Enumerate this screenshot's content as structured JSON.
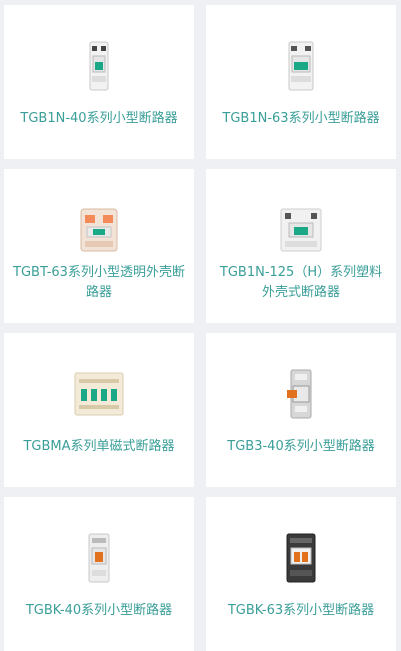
{
  "products": [
    {
      "name": "TGB1N-40系列小型断路器",
      "icon": "mcb-1p-icon"
    },
    {
      "name": "TGB1N-63系列小型断路器",
      "icon": "mcb-2p-icon"
    },
    {
      "name": "TGBT-63系列小型透明外壳断路器",
      "icon": "mcb-transparent-icon"
    },
    {
      "name": "TGB1N-125（H）系列塑料外壳式断路器",
      "icon": "mcb-125-icon"
    },
    {
      "name": "TGBMA系列单磁式断路器",
      "icon": "mcb-4p-icon"
    },
    {
      "name": "TGB3-40系列小型断路器",
      "icon": "mcb-din-icon"
    },
    {
      "name": "TGBK-40系列小型断路器",
      "icon": "mcb-tgbk40-icon"
    },
    {
      "name": "TGBK-63系列小型断路器",
      "icon": "mcb-tgbk63-icon"
    }
  ],
  "colors": {
    "label": "#3a9e98",
    "accent": "#1aa886",
    "orange": "#e2711d"
  }
}
